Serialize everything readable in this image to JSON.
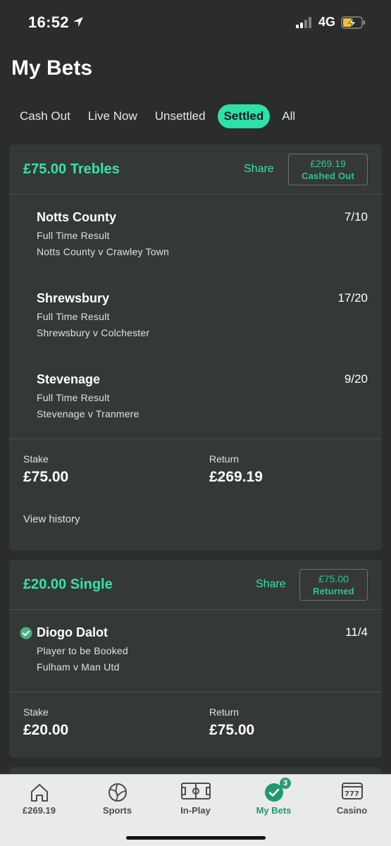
{
  "status_bar": {
    "time": "16:52",
    "network": "4G",
    "icons": [
      "location-arrow-icon",
      "signal-bars-icon",
      "battery-charging-icon"
    ]
  },
  "page": {
    "title": "My Bets"
  },
  "tabs": [
    {
      "label": "Cash Out",
      "active": false
    },
    {
      "label": "Live Now",
      "active": false
    },
    {
      "label": "Unsettled",
      "active": false
    },
    {
      "label": "Settled",
      "active": true
    },
    {
      "label": "All",
      "active": false
    }
  ],
  "colors": {
    "accent": "#2de1a9",
    "background": "#2a2d2b",
    "card": "#353936",
    "nav_active": "#1f9a6c"
  },
  "bets": [
    {
      "title": "£75.00 Trebles",
      "share_label": "Share",
      "badge_amount": "£269.19",
      "badge_label": "Cashed Out",
      "selections": [
        {
          "name": "Notts County",
          "odds": "7/10",
          "market": "Full Time Result",
          "event": "Notts County v Crawley Town"
        },
        {
          "name": "Shrewsbury",
          "odds": "17/20",
          "market": "Full Time Result",
          "event": "Shrewsbury v Colchester"
        },
        {
          "name": "Stevenage",
          "odds": "9/20",
          "market": "Full Time Result",
          "event": "Stevenage v Tranmere"
        }
      ],
      "stake_label": "Stake",
      "stake_value": "£75.00",
      "return_label": "Return",
      "return_value": "£269.19",
      "view_history_label": "View history"
    },
    {
      "title": "£20.00 Single",
      "share_label": "Share",
      "badge_amount": "£75.00",
      "badge_label": "Returned",
      "selections": [
        {
          "name": "Diogo Dalot",
          "odds": "11/4",
          "market": "Player to be Booked",
          "event": "Fulham v Man Utd",
          "status_icon": "check-circle-icon"
        }
      ],
      "stake_label": "Stake",
      "stake_value": "£20.00",
      "return_label": "Return",
      "return_value": "£75.00"
    }
  ],
  "bottom_nav": [
    {
      "label": "£269.19",
      "icon": "home-icon",
      "active": false
    },
    {
      "label": "Sports",
      "icon": "football-icon",
      "active": false
    },
    {
      "label": "In-Play",
      "icon": "pitch-icon",
      "active": false
    },
    {
      "label": "My Bets",
      "icon": "check-circle-icon",
      "active": true,
      "badge": "3"
    },
    {
      "label": "Casino",
      "icon": "slot-machine-icon",
      "active": false
    }
  ]
}
